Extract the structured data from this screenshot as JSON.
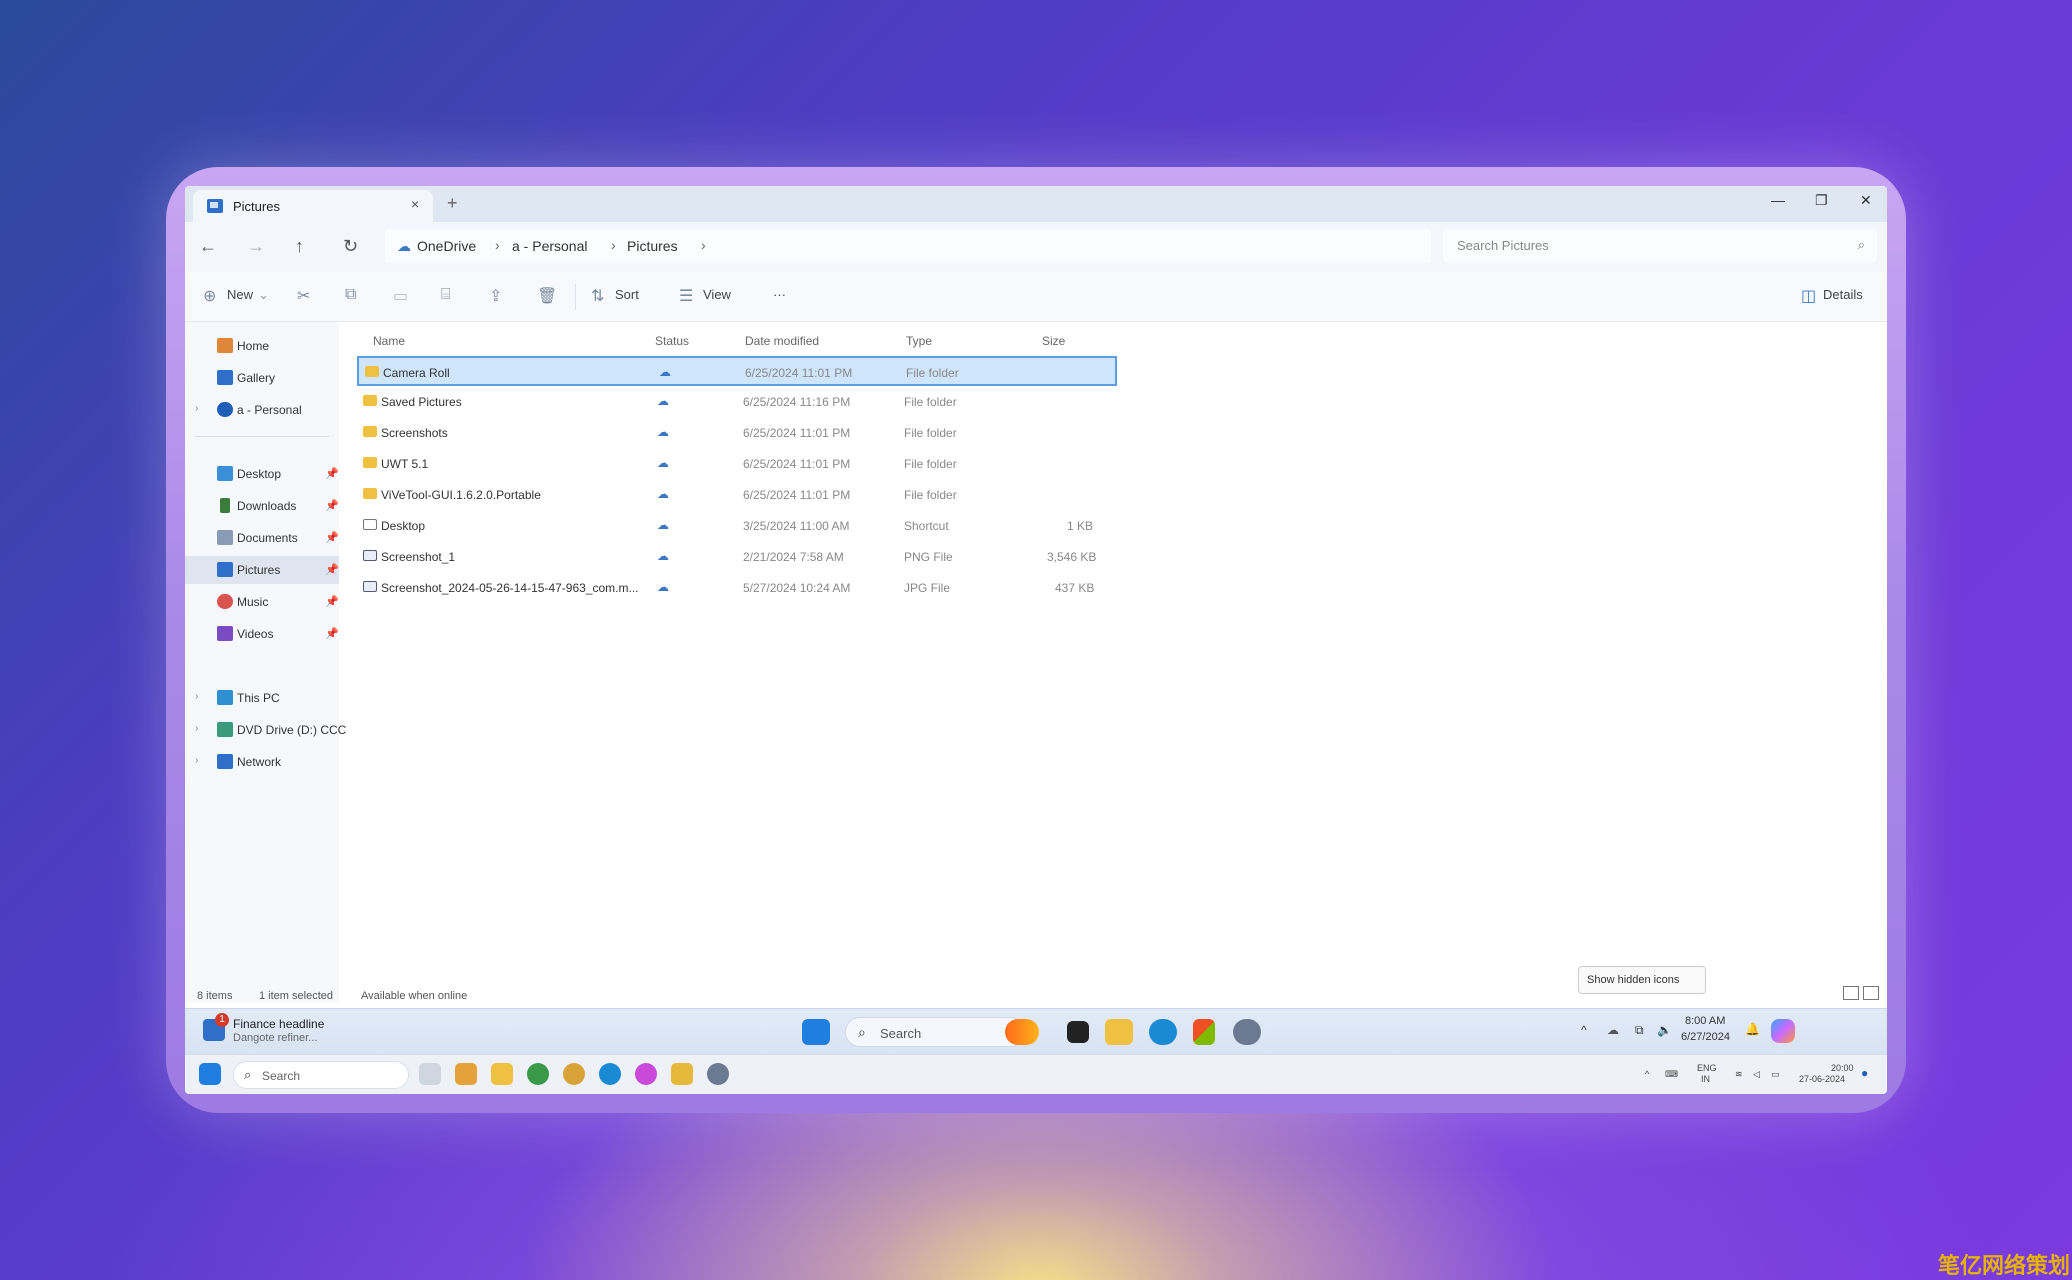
{
  "window": {
    "tab_title": "Pictures",
    "tab_close": "×",
    "tab_add": "+",
    "minimize": "—",
    "restore": "❐",
    "close": "✕"
  },
  "nav": {
    "breadcrumb": [
      "OneDrive",
      "a - Personal",
      "Pictures"
    ],
    "search_placeholder": "Search Pictures"
  },
  "toolbar": {
    "new_label": "New",
    "sort_label": "Sort",
    "view_label": "View",
    "more_label": "···",
    "details_label": "Details"
  },
  "sidebar": {
    "items": [
      {
        "label": "Home",
        "icon": "home-icon",
        "color": "#e0863a"
      },
      {
        "label": "Gallery",
        "icon": "gallery-icon",
        "color": "#2f6fc9"
      },
      {
        "label": "a - Personal",
        "icon": "onedrive-icon",
        "color": "#1f5fb8"
      },
      {
        "label": "Desktop",
        "icon": "desktop-icon",
        "color": "#3b8fd9"
      },
      {
        "label": "Downloads",
        "icon": "download-icon",
        "color": "#3a7d3a"
      },
      {
        "label": "Documents",
        "icon": "documents-icon",
        "color": "#8a9bb5"
      },
      {
        "label": "Pictures",
        "icon": "pictures-icon",
        "color": "#2f6fc9"
      },
      {
        "label": "Music",
        "icon": "music-icon",
        "color": "#d9534f"
      },
      {
        "label": "Videos",
        "icon": "videos-icon",
        "color": "#7b4bc4"
      },
      {
        "label": "This PC",
        "icon": "pc-icon",
        "color": "#2f8fd1"
      },
      {
        "label": "DVD Drive (D:) CCC",
        "icon": "dvd-icon",
        "color": "#3a9a7a"
      },
      {
        "label": "Network",
        "icon": "network-icon",
        "color": "#2f6fc9"
      }
    ]
  },
  "columns": [
    "Name",
    "Status",
    "Date modified",
    "Type",
    "Size"
  ],
  "files": [
    {
      "name": "Camera Roll",
      "date": "6/25/2024 11:01 PM",
      "type": "File folder",
      "size": "",
      "kind": "folder"
    },
    {
      "name": "Saved Pictures",
      "date": "6/25/2024 11:16 PM",
      "type": "File folder",
      "size": "",
      "kind": "folder"
    },
    {
      "name": "Screenshots",
      "date": "6/25/2024 11:01 PM",
      "type": "File folder",
      "size": "",
      "kind": "folder"
    },
    {
      "name": "UWT 5.1",
      "date": "6/25/2024 11:01 PM",
      "type": "File folder",
      "size": "",
      "kind": "folder"
    },
    {
      "name": "ViVeTool-GUI.1.6.2.0.Portable",
      "date": "6/25/2024 11:01 PM",
      "type": "File folder",
      "size": "",
      "kind": "folder"
    },
    {
      "name": "Desktop",
      "date": "3/25/2024 11:00 AM",
      "type": "Shortcut",
      "size": "1 KB",
      "kind": "doc"
    },
    {
      "name": "Screenshot_1",
      "date": "2/21/2024 7:58 AM",
      "type": "PNG File",
      "size": "3,546 KB",
      "kind": "png"
    },
    {
      "name": "Screenshot_2024-05-26-14-15-47-963_com.m...",
      "date": "5/27/2024 10:24 AM",
      "type": "JPG File",
      "size": "437 KB",
      "kind": "png"
    }
  ],
  "status": {
    "items": "8 items",
    "selected": "1 item selected",
    "availability": "Available when online",
    "tooltip": "Show hidden icons"
  },
  "taskbar": {
    "news_title": "Finance headline",
    "news_sub": "Dangote refiner...",
    "news_badge": "1",
    "search_label": "Search",
    "time": "8:00 AM",
    "date": "6/27/2024"
  },
  "taskbar2": {
    "search_label": "Search",
    "lang": "ENG",
    "lang_sub": "IN",
    "time": "20:00",
    "date": "27-06-2024"
  },
  "watermark": "笔亿网络策划"
}
